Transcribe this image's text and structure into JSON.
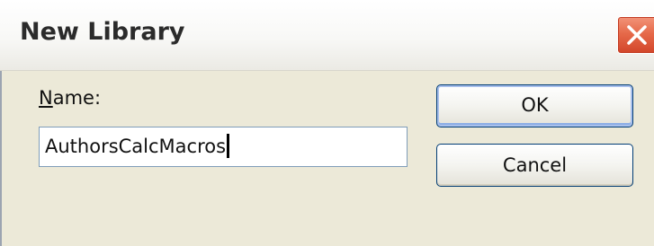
{
  "dialog": {
    "title": "New Library",
    "close_icon": "close-icon",
    "name_label_accel": "N",
    "name_label_rest": "ame:",
    "name_value": "AuthorsCalcMacros",
    "ok_label": "OK",
    "cancel_label": "Cancel"
  },
  "colors": {
    "dialog_background": "#ece9d8",
    "close_button": "#e66a4a",
    "input_border": "#7f9db9",
    "default_button_border": "#003c74"
  }
}
